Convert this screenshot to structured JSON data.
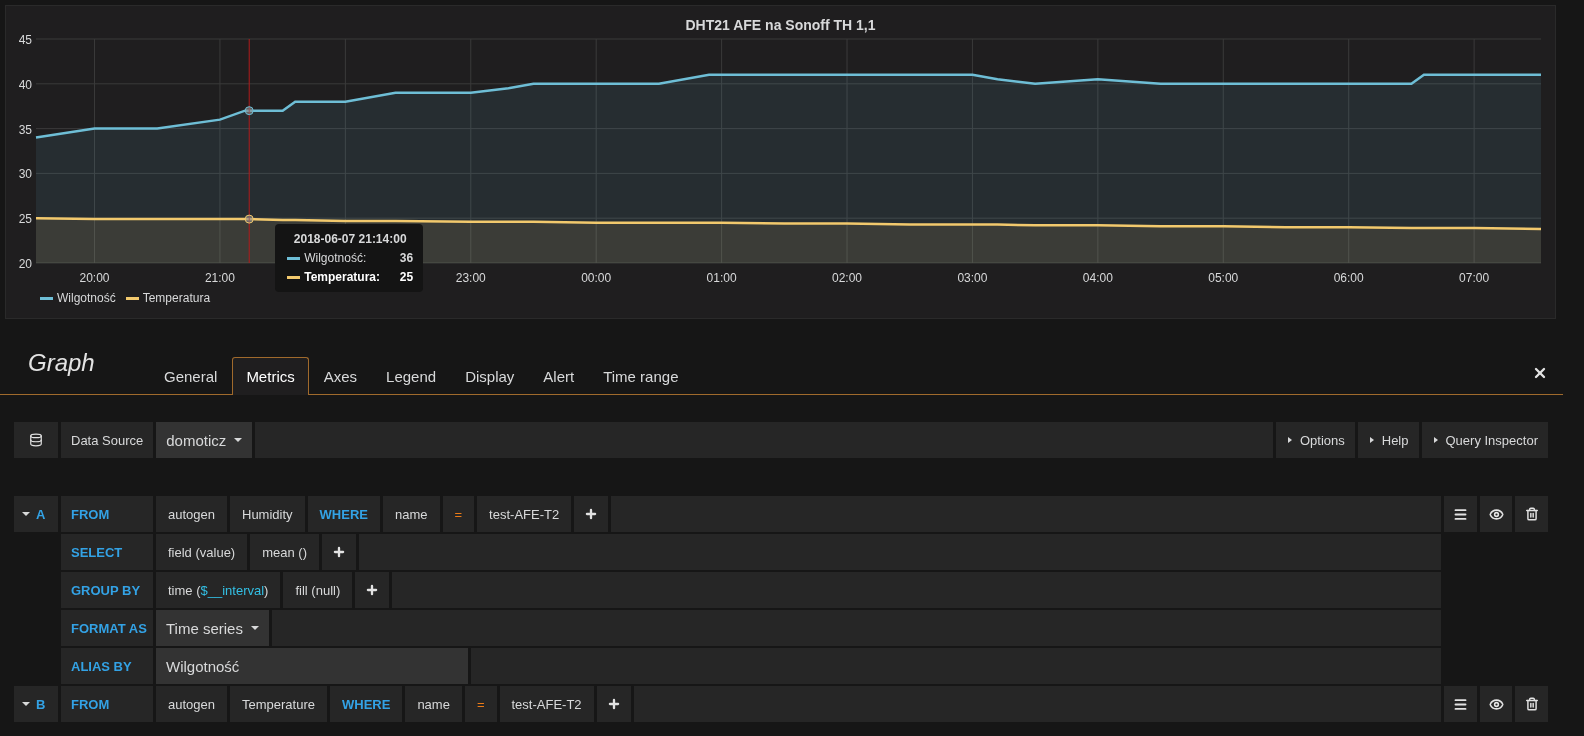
{
  "panel": {
    "title": "DHT21 AFE na Sonoff TH 1,1",
    "chart_data": {
      "type": "area",
      "x": [
        "2018-06-07T19:32",
        "2018-06-07T20:00",
        "2018-06-07T20:30",
        "2018-06-07T21:00",
        "2018-06-07T21:12",
        "2018-06-07T21:30",
        "2018-06-07T21:36",
        "2018-06-07T22:00",
        "2018-06-07T22:24",
        "2018-06-07T23:00",
        "2018-06-07T23:18",
        "2018-06-07T23:30",
        "2018-06-08T00:00",
        "2018-06-08T00:30",
        "2018-06-08T00:54",
        "2018-06-08T01:00",
        "2018-06-08T01:30",
        "2018-06-08T02:00",
        "2018-06-08T02:30",
        "2018-06-08T03:00",
        "2018-06-08T03:12",
        "2018-06-08T03:30",
        "2018-06-08T04:00",
        "2018-06-08T04:30",
        "2018-06-08T05:00",
        "2018-06-08T05:30",
        "2018-06-08T06:00",
        "2018-06-08T06:30",
        "2018-06-08T06:36",
        "2018-06-08T07:00",
        "2018-06-08T07:32"
      ],
      "series": [
        {
          "name": "Wilgotność",
          "color": "#6ebed6",
          "values": [
            34,
            35,
            35,
            36,
            37,
            37,
            38,
            38,
            39,
            39,
            39.5,
            40,
            40,
            40,
            41,
            41,
            41,
            41,
            41,
            41,
            40.5,
            40,
            40.5,
            40,
            40,
            40,
            40,
            40,
            41,
            41,
            41
          ]
        },
        {
          "name": "Temperatura",
          "color": "#f2c96d",
          "values": [
            25,
            24.9,
            24.9,
            24.9,
            24.9,
            24.8,
            24.8,
            24.7,
            24.7,
            24.6,
            24.6,
            24.6,
            24.5,
            24.5,
            24.5,
            24.5,
            24.4,
            24.4,
            24.3,
            24.3,
            24.3,
            24.2,
            24.2,
            24.1,
            24.1,
            24,
            24,
            23.9,
            23.9,
            23.9,
            23.8
          ]
        }
      ],
      "xlim": [
        "2018-06-07T19:32",
        "2018-06-08T07:32"
      ],
      "ylim": [
        20,
        45
      ],
      "xticks": [
        {
          "value": "2018-06-07T20:00",
          "label": "20:00"
        },
        {
          "value": "2018-06-07T21:00",
          "label": "21:00"
        },
        {
          "value": "2018-06-07T23:00",
          "label": "23:00"
        },
        {
          "value": "2018-06-08T00:00",
          "label": "00:00"
        },
        {
          "value": "2018-06-08T01:00",
          "label": "01:00"
        },
        {
          "value": "2018-06-08T02:00",
          "label": "02:00"
        },
        {
          "value": "2018-06-08T03:00",
          "label": "03:00"
        },
        {
          "value": "2018-06-08T04:00",
          "label": "04:00"
        },
        {
          "value": "2018-06-08T05:00",
          "label": "05:00"
        },
        {
          "value": "2018-06-08T06:00",
          "label": "06:00"
        },
        {
          "value": "2018-06-08T07:00",
          "label": "07:00"
        }
      ],
      "yticks": [
        20,
        25,
        30,
        35,
        40,
        45
      ],
      "grid": true,
      "ref_lines": [
        {
          "axis": "x",
          "value": "2018-06-07T21:14",
          "color": "#b01c1c"
        }
      ]
    },
    "tooltip": {
      "time": "2018-06-07 21:14:00",
      "rows": [
        {
          "name": "Wilgotność:",
          "value": "36",
          "bold": false,
          "color": "#6ebed6"
        },
        {
          "name": "Temperatura:",
          "value": "25",
          "bold": true,
          "color": "#f2c96d"
        }
      ]
    }
  },
  "editor": {
    "title": "Graph",
    "tabs": [
      {
        "label": "General",
        "selected": false
      },
      {
        "label": "Metrics",
        "selected": true
      },
      {
        "label": "Axes",
        "selected": false
      },
      {
        "label": "Legend",
        "selected": false
      },
      {
        "label": "Display",
        "selected": false
      },
      {
        "label": "Alert",
        "selected": false
      },
      {
        "label": "Time range",
        "selected": false
      }
    ],
    "datasource": {
      "label": "Data Source",
      "value": "domoticz"
    },
    "actions": [
      "Options",
      "Help",
      "Query Inspector"
    ],
    "queries": [
      {
        "ref": "A",
        "expanded": true,
        "rows": [
          {
            "keyword": "FROM",
            "parts": [
              {
                "kind": "segment",
                "text": "autogen"
              },
              {
                "kind": "segment",
                "text": "Humidity"
              },
              {
                "kind": "keyword",
                "text": "WHERE"
              },
              {
                "kind": "segment",
                "text": "name"
              },
              {
                "kind": "operator",
                "text": "="
              },
              {
                "kind": "segment",
                "text": "test-AFE-T2"
              },
              {
                "kind": "add"
              }
            ]
          },
          {
            "keyword": "SELECT",
            "parts": [
              {
                "kind": "segment",
                "text": "field (value)"
              },
              {
                "kind": "segment",
                "text": "mean ()"
              },
              {
                "kind": "add"
              }
            ]
          },
          {
            "keyword": "GROUP BY",
            "parts": [
              {
                "kind": "template",
                "before": "time (",
                "var": "$__interval",
                "after": ")"
              },
              {
                "kind": "segment",
                "text": "fill (null)"
              },
              {
                "kind": "add"
              }
            ]
          },
          {
            "keyword": "FORMAT AS",
            "parts": [
              {
                "kind": "select",
                "text": "Time series"
              }
            ]
          },
          {
            "keyword": "ALIAS BY",
            "parts": [
              {
                "kind": "input",
                "text": "Wilgotność"
              }
            ]
          }
        ]
      },
      {
        "ref": "B",
        "expanded": true,
        "rows": [
          {
            "keyword": "FROM",
            "parts": [
              {
                "kind": "segment",
                "text": "autogen"
              },
              {
                "kind": "segment",
                "text": "Temperature"
              },
              {
                "kind": "keyword",
                "text": "WHERE"
              },
              {
                "kind": "segment",
                "text": "name"
              },
              {
                "kind": "operator",
                "text": "="
              },
              {
                "kind": "segment",
                "text": "test-AFE-T2"
              },
              {
                "kind": "add"
              }
            ]
          }
        ]
      }
    ]
  }
}
